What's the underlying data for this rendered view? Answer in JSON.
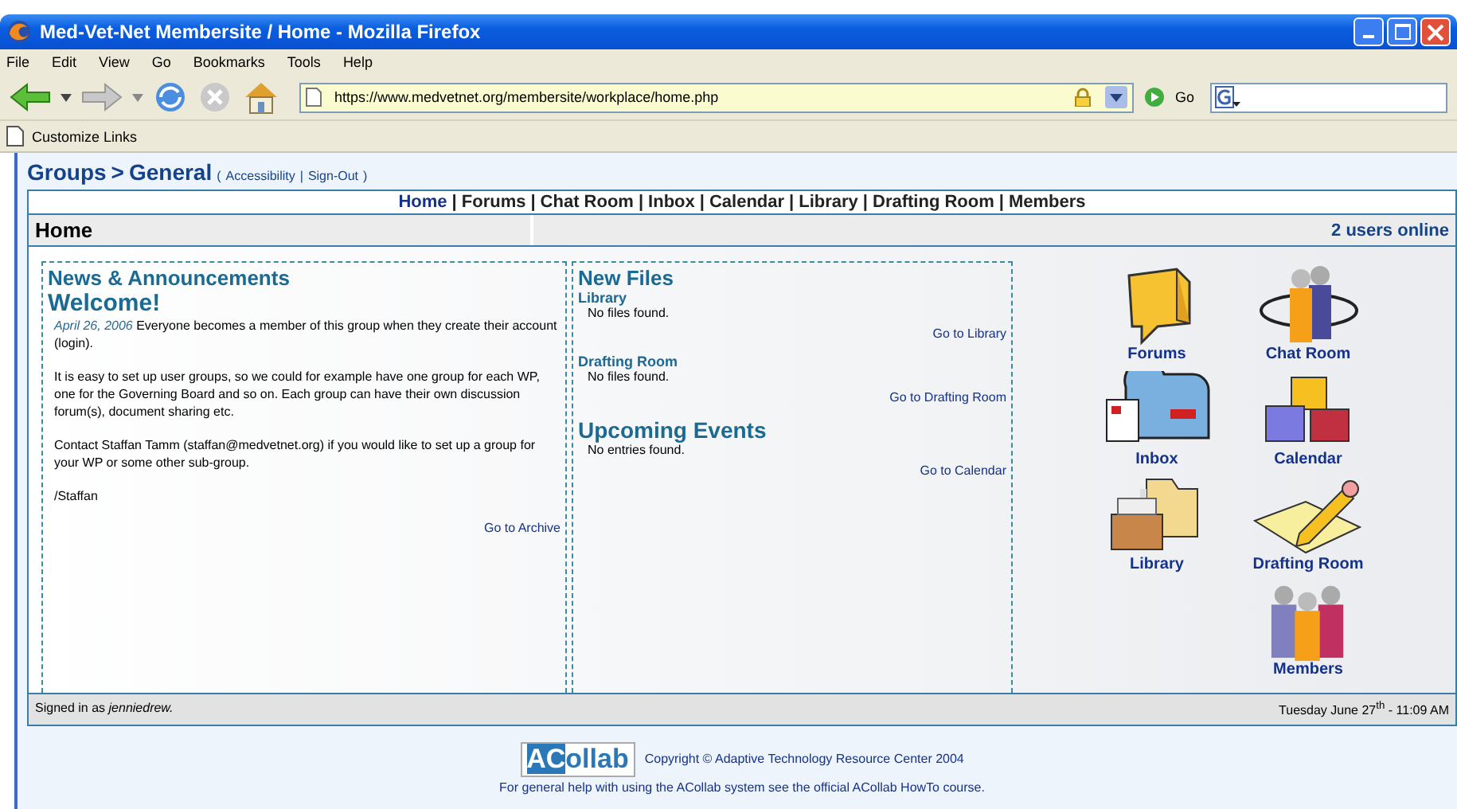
{
  "window": {
    "title": "Med-Vet-Net Membersite / Home - Mozilla Firefox"
  },
  "menu": [
    "File",
    "Edit",
    "View",
    "Go",
    "Bookmarks",
    "Tools",
    "Help"
  ],
  "toolbar": {
    "url": "https://www.medvetnet.org/membersite/workplace/home.php",
    "go": "Go"
  },
  "links_bar": [
    "Customize Links"
  ],
  "breadcrumb": {
    "groups": "Groups",
    "separator": ">",
    "current": "General",
    "links": [
      "Accessibility",
      "Sign-Out"
    ],
    "open": "(",
    "link_separator": "|",
    "close": ")"
  },
  "nav_separator": "|",
  "nav": [
    {
      "label": "Home",
      "selected": true
    },
    {
      "label": "Forums",
      "selected": false
    },
    {
      "label": "Chat Room",
      "selected": false
    },
    {
      "label": "Inbox",
      "selected": false
    },
    {
      "label": "Calendar",
      "selected": false
    },
    {
      "label": "Library",
      "selected": false
    },
    {
      "label": "Drafting Room",
      "selected": false
    },
    {
      "label": "Members",
      "selected": false
    }
  ],
  "header": {
    "title": "Home",
    "users_online": "2 users online"
  },
  "news": {
    "title": "News & Announcements",
    "post_title": "Welcome!",
    "date": "April 26, 2006",
    "first_text": "Everyone becomes a member of this group when they create their account (login).",
    "paragraphs": [
      "It is easy to set up user groups, so we could for example have one group for each WP, one for the Governing Board and so on. Each group can have their own discussion forum(s), document sharing etc.",
      "Contact Staffan Tamm (staffan@medvetnet.org) if you would like to set up a group for your WP or some other sub-group.",
      "/Staffan"
    ],
    "link": "Go to Archive"
  },
  "new_files": {
    "title": "New Files",
    "sections": [
      {
        "title": "Library",
        "empty": "No files found.",
        "link": "Go to Library"
      },
      {
        "title": "Drafting Room",
        "empty": "No files found.",
        "link": "Go to Drafting Room"
      }
    ]
  },
  "events": {
    "title": "Upcoming Events",
    "empty": "No entries found.",
    "link": "Go to Calendar"
  },
  "tools": [
    {
      "kind": "forums",
      "label": "Forums"
    },
    {
      "kind": "chat",
      "label": "Chat Room"
    },
    {
      "kind": "inbox",
      "label": "Inbox"
    },
    {
      "kind": "calendar",
      "label": "Calendar"
    },
    {
      "kind": "library",
      "label": "Library"
    },
    {
      "kind": "drafting",
      "label": "Drafting Room"
    },
    {
      "kind": "members",
      "label": "Members"
    }
  ],
  "status": {
    "prefix": "Signed in as",
    "user": "jenniedrew.",
    "datetime": "Tuesday June 27$^{th}$ - 11:09 AM"
  },
  "footer": {
    "logo_highlight": "AC",
    "logo_rest": "ollab",
    "copyright": "Copyright © Adaptive Technology Resource Center 2004",
    "help": "For general help with using the ACollab system see the official ACollab HowTo course."
  }
}
